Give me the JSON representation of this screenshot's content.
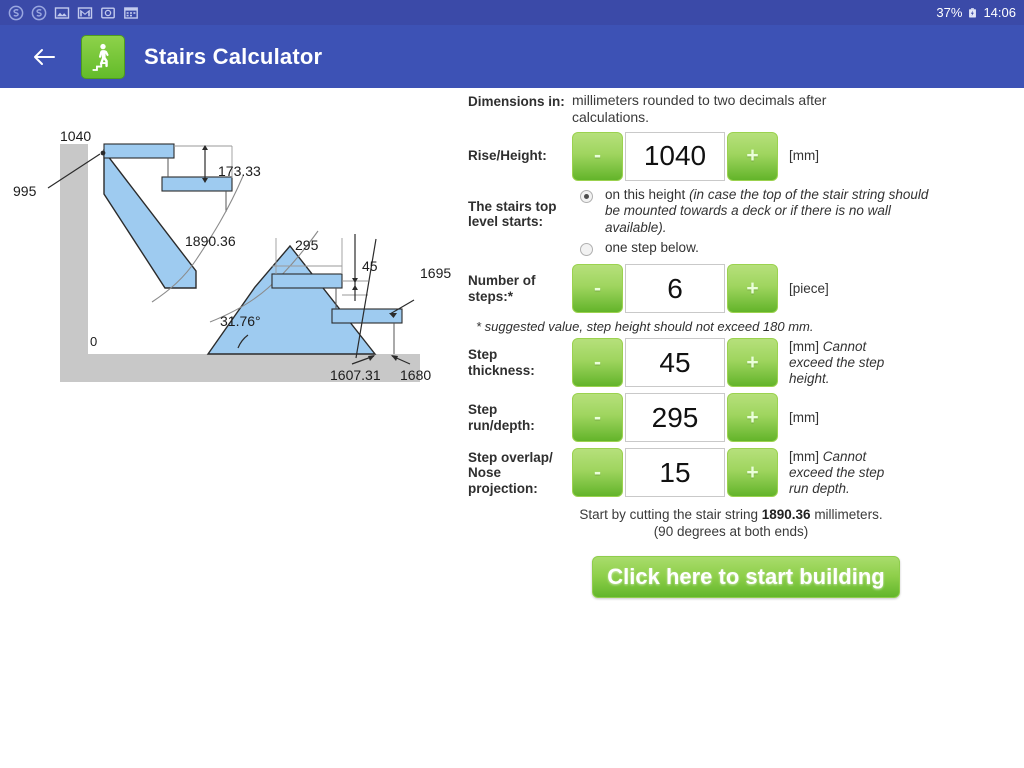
{
  "status_bar": {
    "icons": [
      "skype-icon",
      "skype-icon",
      "image-icon",
      "gmail-icon",
      "camera-icon",
      "calendar-icon"
    ],
    "battery_percent": "37%",
    "battery_icon": "battery-charging-icon",
    "time": "14:06",
    "background": "#3b4aa8"
  },
  "app_bar": {
    "back_label": "back-arrow",
    "icon_name": "stairs-walking-person-icon",
    "title": "Stairs Calculator",
    "background": "#3d52b5"
  },
  "diagram": {
    "name": "stairs-section-diagram",
    "labels": {
      "total_rise": "1040",
      "wall_height": "995",
      "step_rise": "173.33",
      "stringer_length": "1890.36",
      "step_run": "295",
      "step_thickness": "45",
      "last_step_run": "1695",
      "stringer_horizontal": "1607.31",
      "total_run": "1680",
      "angle": "31.76°",
      "origin": "0"
    },
    "colors": {
      "wall": "#c8c8c8",
      "step_fill": "#9ecbf0",
      "outline": "#3a3a3a"
    }
  },
  "form": {
    "dimensions": {
      "label": "Dimensions in:",
      "value": "millimeters rounded to two decimals after calculations."
    },
    "rise": {
      "label": "Rise/Height:",
      "minus": "-",
      "plus": "+",
      "value": "1040",
      "unit": "[mm]"
    },
    "top_level": {
      "label": "The stairs top level starts:",
      "options": [
        {
          "selected": true,
          "text_plain": "on this height ",
          "text_italic": "(in case the top of the stair string should be mounted towards a deck or if there is no wall available)."
        },
        {
          "selected": false,
          "text_plain": "one step below.",
          "text_italic": ""
        }
      ]
    },
    "steps": {
      "label": "Number of steps:*",
      "minus": "-",
      "plus": "+",
      "value": "6",
      "unit": "[piece]"
    },
    "footnote": "* suggested value, step height should not exceed 180 mm.",
    "thickness": {
      "label": "Step thickness:",
      "minus": "-",
      "plus": "+",
      "value": "45",
      "unit": "[mm] ",
      "unit_italic": "Cannot exceed the step height."
    },
    "run": {
      "label": "Step run/depth:",
      "minus": "-",
      "plus": "+",
      "value": "295",
      "unit": "[mm]",
      "unit_italic": ""
    },
    "overlap": {
      "label": "Step overlap/ Nose projection:",
      "minus": "-",
      "plus": "+",
      "value": "15",
      "unit": "[mm] ",
      "unit_italic": "Cannot exceed the step run depth."
    },
    "result": {
      "prefix": "Start by cutting the stair string ",
      "value": "1890.36",
      "suffix": " millimeters.",
      "second_line": "(90 degrees at both ends)"
    },
    "build_button": "Click here to start building"
  }
}
